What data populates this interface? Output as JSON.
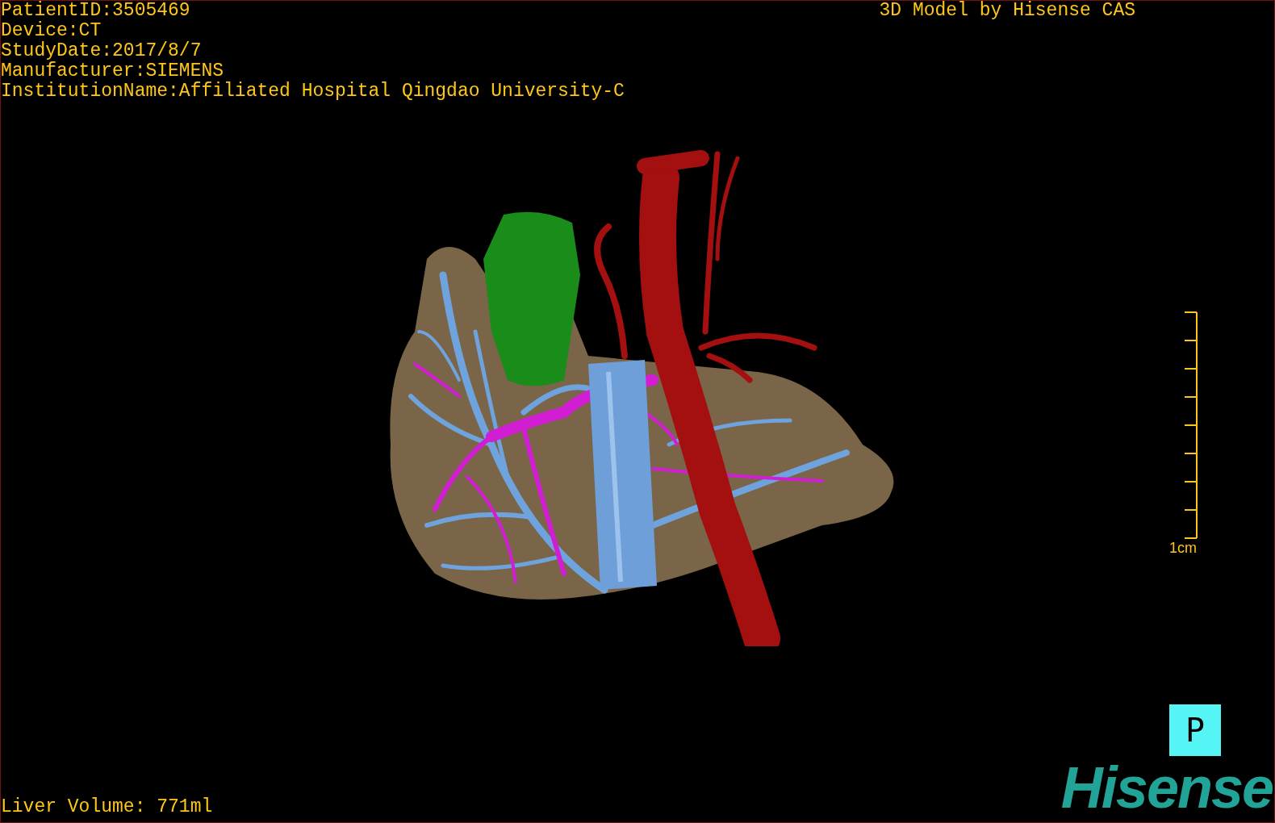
{
  "info_lines": [
    "PatientID:3505469",
    "Device:CT",
    "StudyDate:2017/8/7",
    "Manufacturer:SIEMENS",
    "InstitutionName:Affiliated Hospital Qingdao University-C"
  ],
  "title": "3D Model by Hisense CAS",
  "scale": {
    "label": "1cm"
  },
  "view_button": "P",
  "logo": "Hisense",
  "liver_volume": "Liver Volume: 771ml"
}
